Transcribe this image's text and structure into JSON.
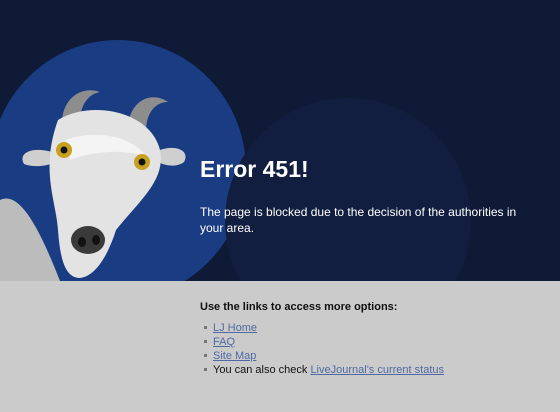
{
  "colors": {
    "hero_background": "#0f1a36",
    "hero_circle": "#1a3c82",
    "footer_background": "#cbcbcb",
    "link": "#4f6aa3"
  },
  "hero": {
    "title": "Error 451!",
    "message": "The page is blocked due to the decision of the authorities in your area.",
    "image_icon": "goat-illustration"
  },
  "footer": {
    "heading": "Use the links to access more options:",
    "links": [
      {
        "label": "LJ Home"
      },
      {
        "label": "FAQ"
      },
      {
        "label": "Site Map"
      }
    ],
    "status_prefix": "You can also check ",
    "status_link": "LiveJournal's current status"
  }
}
